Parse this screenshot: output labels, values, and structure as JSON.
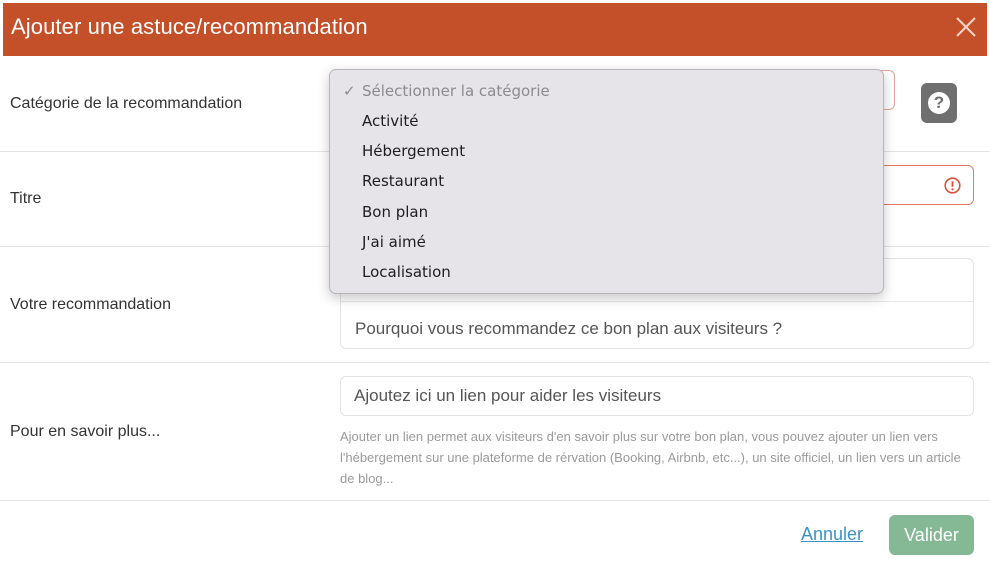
{
  "header": {
    "title": "Ajouter une astuce/recommandation"
  },
  "form": {
    "category": {
      "label": "Catégorie de la recommandation"
    },
    "title": {
      "label": "Titre"
    },
    "recommendation": {
      "label": "Votre recommandation",
      "placeholder": "Pourquoi vous recommandez ce bon plan aux visiteurs ?"
    },
    "link": {
      "label": "Pour en savoir plus...",
      "placeholder": "Ajoutez ici un lien pour aider les visiteurs",
      "help": "Ajouter un lien permet aux visiteurs d'en savoir plus sur votre bon plan, vous pouvez ajouter un lien vers l'hébergement sur une plateforme de rérvation (Booking, Airbnb, etc...), un site officiel, un lien vers un article de blog..."
    }
  },
  "dropdown": {
    "check_glyph": "✓",
    "selected": "Sélectionner la catégorie",
    "options": [
      "Activité",
      "Hébergement",
      "Restaurant",
      "Bon plan",
      "J'ai aimé",
      "Localisation"
    ]
  },
  "footer": {
    "cancel": "Annuler",
    "submit": "Valider"
  },
  "colors": {
    "header": "#c4502a",
    "submit": "#85b894",
    "cancel_link": "#3a92c9",
    "error_border": "#e07a67",
    "help_button": "#6f6f6f"
  },
  "icons": {
    "close": "close-icon",
    "help": "question-icon",
    "warning": "warning-icon",
    "check": "check-icon"
  }
}
